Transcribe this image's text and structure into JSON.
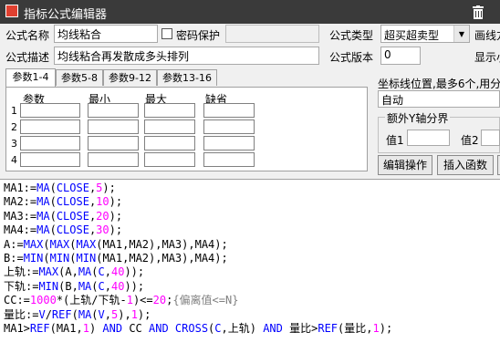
{
  "window": {
    "title": "指标公式编辑器"
  },
  "form": {
    "name_label": "公式名称",
    "name_value": "均线粘合",
    "password_label": "密码保护",
    "desc_label": "公式描述",
    "desc_value": "均线粘合再发散成多头排列",
    "type_label": "公式类型",
    "type_value": "超买超卖型",
    "version_label": "公式版本",
    "version_value": "0",
    "draw_label": "画线方",
    "show_label": "显示小"
  },
  "tabs": [
    "参数1-4",
    "参数5-8",
    "参数9-12",
    "参数13-16"
  ],
  "params": {
    "headers": [
      "参数",
      "最小",
      "最大",
      "缺省"
    ],
    "rows": [
      "1",
      "2",
      "3",
      "4"
    ]
  },
  "axis": {
    "label": "坐标线位置,最多6个,用分",
    "value": "自动",
    "y_group_label": "额外Y轴分界",
    "val1_label": "值1",
    "val2_label": "值2"
  },
  "buttons": {
    "edit": "编辑操作",
    "insert": "插入函数"
  },
  "code": [
    [
      [
        "MA1:=",
        "t"
      ],
      [
        "MA",
        "k"
      ],
      [
        "(",
        "t"
      ],
      [
        "CLOSE",
        "k"
      ],
      [
        ",",
        "t"
      ],
      [
        "5",
        "n"
      ],
      [
        ");",
        "t"
      ]
    ],
    [
      [
        "MA2:=",
        "t"
      ],
      [
        "MA",
        "k"
      ],
      [
        "(",
        "t"
      ],
      [
        "CLOSE",
        "k"
      ],
      [
        ",",
        "t"
      ],
      [
        "10",
        "n"
      ],
      [
        ");",
        "t"
      ]
    ],
    [
      [
        "MA3:=",
        "t"
      ],
      [
        "MA",
        "k"
      ],
      [
        "(",
        "t"
      ],
      [
        "CLOSE",
        "k"
      ],
      [
        ",",
        "t"
      ],
      [
        "20",
        "n"
      ],
      [
        ");",
        "t"
      ]
    ],
    [
      [
        "MA4:=",
        "t"
      ],
      [
        "MA",
        "k"
      ],
      [
        "(",
        "t"
      ],
      [
        "CLOSE",
        "k"
      ],
      [
        ",",
        "t"
      ],
      [
        "30",
        "n"
      ],
      [
        ");",
        "t"
      ]
    ],
    [
      [
        "A:=",
        "t"
      ],
      [
        "MAX",
        "k"
      ],
      [
        "(",
        "t"
      ],
      [
        "MAX",
        "k"
      ],
      [
        "(",
        "t"
      ],
      [
        "MAX",
        "k"
      ],
      [
        "(MA1,MA2),MA3),MA4);",
        "t"
      ]
    ],
    [
      [
        "B:=",
        "t"
      ],
      [
        "MIN",
        "k"
      ],
      [
        "(",
        "t"
      ],
      [
        "MIN",
        "k"
      ],
      [
        "(",
        "t"
      ],
      [
        "MIN",
        "k"
      ],
      [
        "(MA1,MA2),MA3),MA4);",
        "t"
      ]
    ],
    [
      [
        "上轨:=",
        "t"
      ],
      [
        "MAX",
        "k"
      ],
      [
        "(A,",
        "t"
      ],
      [
        "MA",
        "k"
      ],
      [
        "(",
        "t"
      ],
      [
        "C",
        "k"
      ],
      [
        ",",
        "t"
      ],
      [
        "40",
        "n"
      ],
      [
        "));",
        "t"
      ]
    ],
    [
      [
        "下轨:=",
        "t"
      ],
      [
        "MIN",
        "k"
      ],
      [
        "(B,",
        "t"
      ],
      [
        "MA",
        "k"
      ],
      [
        "(",
        "t"
      ],
      [
        "C",
        "k"
      ],
      [
        ",",
        "t"
      ],
      [
        "40",
        "n"
      ],
      [
        "));",
        "t"
      ]
    ],
    [
      [
        "CC:=",
        "t"
      ],
      [
        "1000",
        "n"
      ],
      [
        "*(上轨/下轨-",
        "t"
      ],
      [
        "1",
        "n"
      ],
      [
        ")<=",
        "t"
      ],
      [
        "20",
        "n"
      ],
      [
        ";",
        "t"
      ],
      [
        "{偏离值<=N}",
        "c"
      ]
    ],
    [
      [
        "量比:=",
        "t"
      ],
      [
        "V",
        "k"
      ],
      [
        "/",
        "t"
      ],
      [
        "REF",
        "k"
      ],
      [
        "(",
        "t"
      ],
      [
        "MA",
        "k"
      ],
      [
        "(",
        "t"
      ],
      [
        "V",
        "k"
      ],
      [
        ",",
        "t"
      ],
      [
        "5",
        "n"
      ],
      [
        "),",
        "t"
      ],
      [
        "1",
        "n"
      ],
      [
        ");",
        "t"
      ]
    ],
    [
      [
        "MA1>",
        "t"
      ],
      [
        "REF",
        "k"
      ],
      [
        "(MA1,",
        "t"
      ],
      [
        "1",
        "n"
      ],
      [
        ") ",
        "t"
      ],
      [
        "AND",
        "k"
      ],
      [
        " CC ",
        "t"
      ],
      [
        "AND",
        "k"
      ],
      [
        " ",
        "t"
      ],
      [
        "CROSS",
        "k"
      ],
      [
        "(",
        "t"
      ],
      [
        "C",
        "k"
      ],
      [
        ",上轨) ",
        "t"
      ],
      [
        "AND",
        "k"
      ],
      [
        " 量比>",
        "t"
      ],
      [
        "REF",
        "k"
      ],
      [
        "(量比,",
        "t"
      ],
      [
        "1",
        "n"
      ],
      [
        ");",
        "t"
      ]
    ]
  ]
}
